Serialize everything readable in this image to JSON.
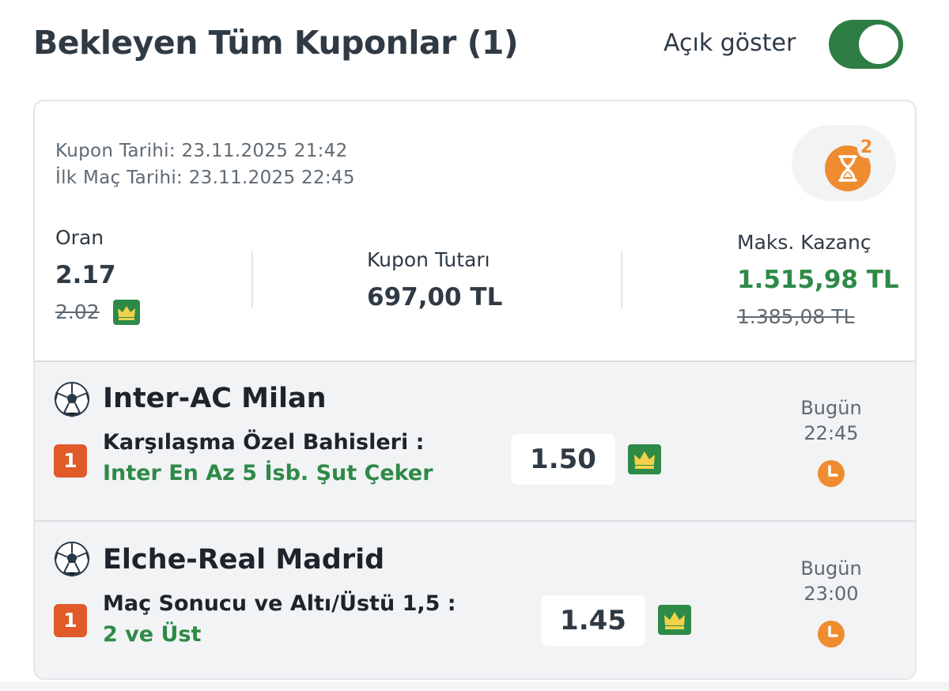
{
  "header": {
    "title": "Bekleyen Tüm Kuponlar (1)",
    "toggle_label": "Açık göster",
    "toggle_on": true
  },
  "coupon": {
    "coupon_date": "Kupon Tarihi: 23.11.2025 21:42",
    "first_match_date": "İlk Maç Tarihi: 23.11.2025 22:45",
    "pending_count": "2",
    "odds_label": "Oran",
    "odds_value": "2.17",
    "odds_old": "2.02",
    "amount_label": "Kupon Tutarı",
    "amount_value": "697,00 TL",
    "max_win_label": "Maks. Kazanç",
    "max_win_value": "1.515,98 TL",
    "max_win_old": "1.385,08 TL"
  },
  "matches": [
    {
      "title": "Inter-AC Milan",
      "pick": "1",
      "market": "Karşılaşma Özel Bahisleri :",
      "selection": "Inter En Az 5 İsb. Şut Çeker",
      "odds": "1.50",
      "day": "Bugün",
      "time": "22:45"
    },
    {
      "title": "Elche-Real Madrid",
      "pick": "1",
      "market": "Maç Sonucu ve Altı/Üstü 1,5 :",
      "selection": "2 ve Üst",
      "odds": "1.45",
      "day": "Bugün",
      "time": "23:00"
    }
  ],
  "colors": {
    "accent_green": "#2e8a47",
    "toggle_green": "#2e7d45",
    "orange": "#ef8c2f",
    "pick_red": "#e05a2a"
  },
  "icons": {
    "pending": "hourglass-icon",
    "boost": "crown-icon",
    "sport": "soccer-ball-icon",
    "time": "clock-icon"
  }
}
